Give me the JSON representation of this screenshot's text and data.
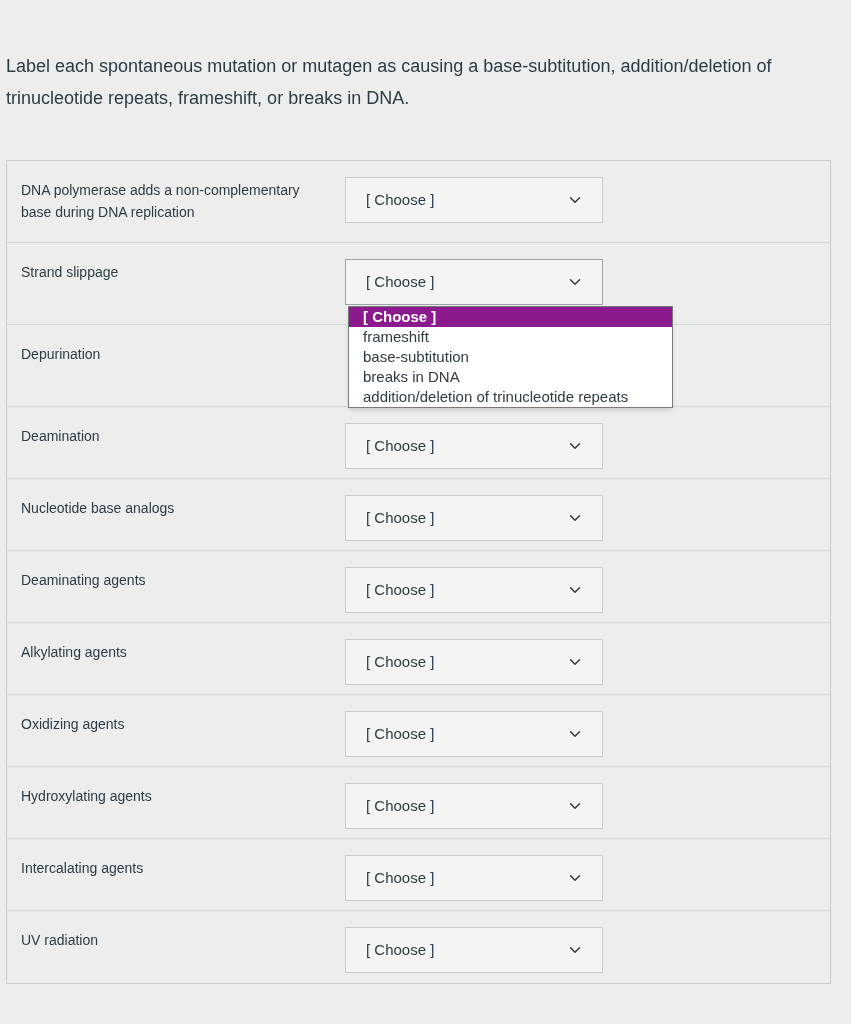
{
  "question": {
    "text": "Label each spontaneous mutation or mutagen as causing a base-subtitution, addition/deletion of trinucleotide repeats, frameshift, or breaks in DNA."
  },
  "items": [
    {
      "label": "DNA polymerase adds a non-complementary base during DNA replication",
      "select": {
        "value": "[ Choose ]",
        "expanded": false
      }
    },
    {
      "label": "Strand slippage",
      "select": {
        "value": "[ Choose ]",
        "expanded": true,
        "options": [
          {
            "label": "[ Choose ]",
            "selected": true
          },
          {
            "label": "frameshift",
            "selected": false
          },
          {
            "label": "base-subtitution",
            "selected": false
          },
          {
            "label": "breaks in DNA",
            "selected": false
          },
          {
            "label": "addition/deletion of trinucleotide repeats",
            "selected": false
          }
        ]
      }
    },
    {
      "label": "Depurination"
    },
    {
      "label": "Deamination",
      "select": {
        "value": "[ Choose ]",
        "expanded": false
      }
    },
    {
      "label": "Nucleotide base analogs",
      "select": {
        "value": "[ Choose ]",
        "expanded": false
      }
    },
    {
      "label": "Deaminating agents",
      "select": {
        "value": "[ Choose ]",
        "expanded": false
      }
    },
    {
      "label": "Alkylating agents",
      "select": {
        "value": "[ Choose ]",
        "expanded": false
      }
    },
    {
      "label": "Oxidizing agents",
      "select": {
        "value": "[ Choose ]",
        "expanded": false
      }
    },
    {
      "label": "Hydroxylating agents",
      "select": {
        "value": "[ Choose ]",
        "expanded": false
      }
    },
    {
      "label": "Intercalating agents",
      "select": {
        "value": "[ Choose ]",
        "expanded": false
      }
    },
    {
      "label": "UV radiation",
      "select": {
        "value": "[ Choose ]",
        "expanded": false
      }
    }
  ]
}
